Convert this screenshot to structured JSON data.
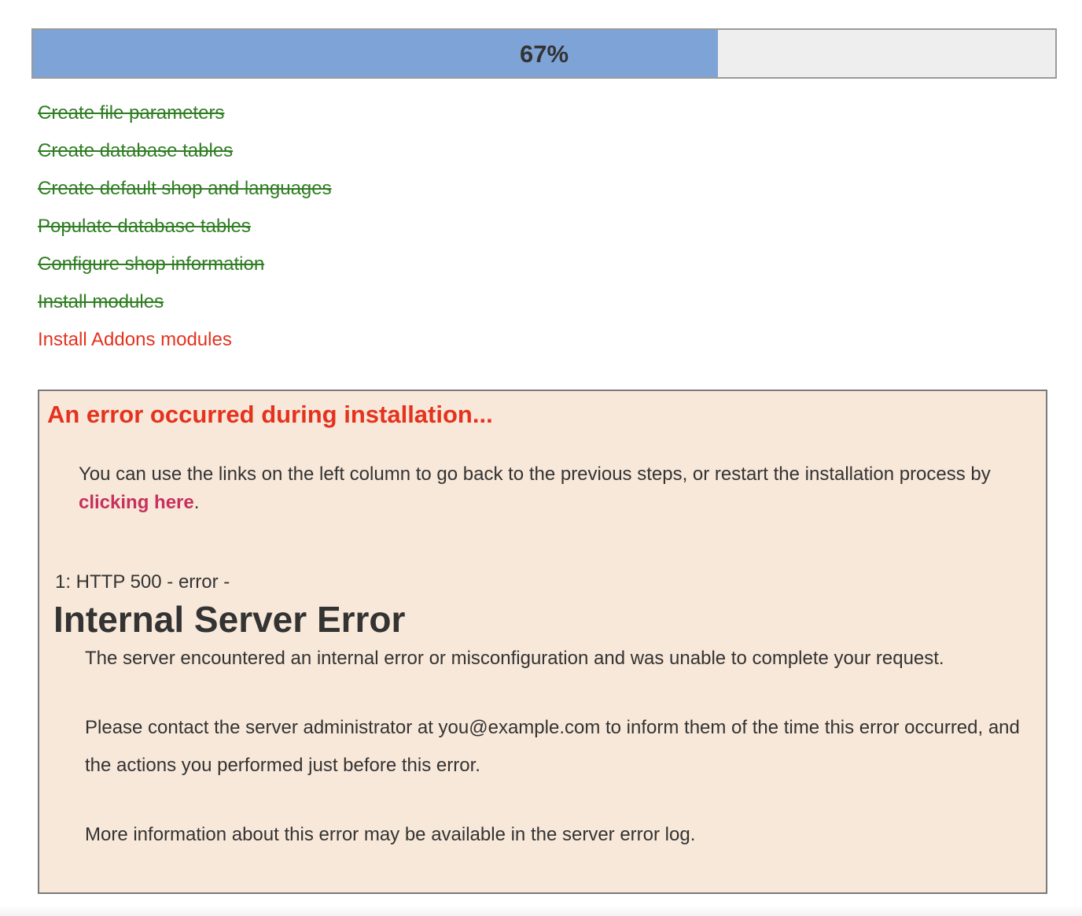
{
  "progress": {
    "percent": 67,
    "label": "67%"
  },
  "steps": [
    {
      "label": "Create file parameters",
      "status": "done"
    },
    {
      "label": "Create database tables",
      "status": "done"
    },
    {
      "label": "Create default shop and languages",
      "status": "done"
    },
    {
      "label": "Populate database tables",
      "status": "done"
    },
    {
      "label": "Configure shop information",
      "status": "done"
    },
    {
      "label": "Install modules",
      "status": "done"
    },
    {
      "label": "Install Addons modules",
      "status": "failed"
    }
  ],
  "error": {
    "title": "An error occurred during installation...",
    "help_before": "You can use the links on the left column to go back to the previous steps, or restart the installation process by ",
    "help_link": "clicking here",
    "help_after": ".",
    "code_line": "1: HTTP 500 - error -",
    "server_title": "Internal Server Error",
    "server_message_1": "The server encountered an internal error or misconfiguration and was unable to complete your request.",
    "server_message_2": "Please contact the server administrator at you@example.com to inform them of the time this error occurred, and the actions you performed just before this error.",
    "server_message_3": "More information about this error may be available in the server error log."
  },
  "colors": {
    "progress_fill": "#7ea3d6",
    "progress_track": "#eeeeee",
    "step_done": "#2f7d22",
    "step_failed": "#e5321f",
    "error_background": "#f8e8d9",
    "error_title": "#e5321f",
    "link": "#c7305e"
  }
}
